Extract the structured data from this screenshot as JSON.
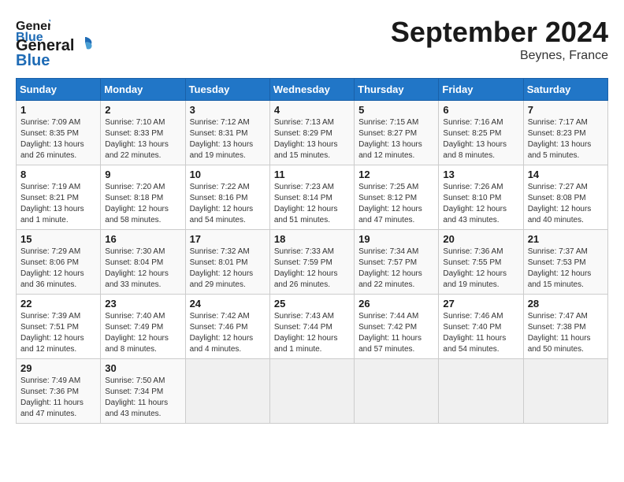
{
  "header": {
    "logo_line1": "General",
    "logo_line2": "Blue",
    "month": "September 2024",
    "location": "Beynes, France"
  },
  "days_of_week": [
    "Sunday",
    "Monday",
    "Tuesday",
    "Wednesday",
    "Thursday",
    "Friday",
    "Saturday"
  ],
  "weeks": [
    [
      {
        "day": "1",
        "info": "Sunrise: 7:09 AM\nSunset: 8:35 PM\nDaylight: 13 hours\nand 26 minutes."
      },
      {
        "day": "2",
        "info": "Sunrise: 7:10 AM\nSunset: 8:33 PM\nDaylight: 13 hours\nand 22 minutes."
      },
      {
        "day": "3",
        "info": "Sunrise: 7:12 AM\nSunset: 8:31 PM\nDaylight: 13 hours\nand 19 minutes."
      },
      {
        "day": "4",
        "info": "Sunrise: 7:13 AM\nSunset: 8:29 PM\nDaylight: 13 hours\nand 15 minutes."
      },
      {
        "day": "5",
        "info": "Sunrise: 7:15 AM\nSunset: 8:27 PM\nDaylight: 13 hours\nand 12 minutes."
      },
      {
        "day": "6",
        "info": "Sunrise: 7:16 AM\nSunset: 8:25 PM\nDaylight: 13 hours\nand 8 minutes."
      },
      {
        "day": "7",
        "info": "Sunrise: 7:17 AM\nSunset: 8:23 PM\nDaylight: 13 hours\nand 5 minutes."
      }
    ],
    [
      {
        "day": "8",
        "info": "Sunrise: 7:19 AM\nSunset: 8:21 PM\nDaylight: 13 hours\nand 1 minute."
      },
      {
        "day": "9",
        "info": "Sunrise: 7:20 AM\nSunset: 8:18 PM\nDaylight: 12 hours\nand 58 minutes."
      },
      {
        "day": "10",
        "info": "Sunrise: 7:22 AM\nSunset: 8:16 PM\nDaylight: 12 hours\nand 54 minutes."
      },
      {
        "day": "11",
        "info": "Sunrise: 7:23 AM\nSunset: 8:14 PM\nDaylight: 12 hours\nand 51 minutes."
      },
      {
        "day": "12",
        "info": "Sunrise: 7:25 AM\nSunset: 8:12 PM\nDaylight: 12 hours\nand 47 minutes."
      },
      {
        "day": "13",
        "info": "Sunrise: 7:26 AM\nSunset: 8:10 PM\nDaylight: 12 hours\nand 43 minutes."
      },
      {
        "day": "14",
        "info": "Sunrise: 7:27 AM\nSunset: 8:08 PM\nDaylight: 12 hours\nand 40 minutes."
      }
    ],
    [
      {
        "day": "15",
        "info": "Sunrise: 7:29 AM\nSunset: 8:06 PM\nDaylight: 12 hours\nand 36 minutes."
      },
      {
        "day": "16",
        "info": "Sunrise: 7:30 AM\nSunset: 8:04 PM\nDaylight: 12 hours\nand 33 minutes."
      },
      {
        "day": "17",
        "info": "Sunrise: 7:32 AM\nSunset: 8:01 PM\nDaylight: 12 hours\nand 29 minutes."
      },
      {
        "day": "18",
        "info": "Sunrise: 7:33 AM\nSunset: 7:59 PM\nDaylight: 12 hours\nand 26 minutes."
      },
      {
        "day": "19",
        "info": "Sunrise: 7:34 AM\nSunset: 7:57 PM\nDaylight: 12 hours\nand 22 minutes."
      },
      {
        "day": "20",
        "info": "Sunrise: 7:36 AM\nSunset: 7:55 PM\nDaylight: 12 hours\nand 19 minutes."
      },
      {
        "day": "21",
        "info": "Sunrise: 7:37 AM\nSunset: 7:53 PM\nDaylight: 12 hours\nand 15 minutes."
      }
    ],
    [
      {
        "day": "22",
        "info": "Sunrise: 7:39 AM\nSunset: 7:51 PM\nDaylight: 12 hours\nand 12 minutes."
      },
      {
        "day": "23",
        "info": "Sunrise: 7:40 AM\nSunset: 7:49 PM\nDaylight: 12 hours\nand 8 minutes."
      },
      {
        "day": "24",
        "info": "Sunrise: 7:42 AM\nSunset: 7:46 PM\nDaylight: 12 hours\nand 4 minutes."
      },
      {
        "day": "25",
        "info": "Sunrise: 7:43 AM\nSunset: 7:44 PM\nDaylight: 12 hours\nand 1 minute."
      },
      {
        "day": "26",
        "info": "Sunrise: 7:44 AM\nSunset: 7:42 PM\nDaylight: 11 hours\nand 57 minutes."
      },
      {
        "day": "27",
        "info": "Sunrise: 7:46 AM\nSunset: 7:40 PM\nDaylight: 11 hours\nand 54 minutes."
      },
      {
        "day": "28",
        "info": "Sunrise: 7:47 AM\nSunset: 7:38 PM\nDaylight: 11 hours\nand 50 minutes."
      }
    ],
    [
      {
        "day": "29",
        "info": "Sunrise: 7:49 AM\nSunset: 7:36 PM\nDaylight: 11 hours\nand 47 minutes."
      },
      {
        "day": "30",
        "info": "Sunrise: 7:50 AM\nSunset: 7:34 PM\nDaylight: 11 hours\nand 43 minutes."
      },
      {
        "day": "",
        "info": ""
      },
      {
        "day": "",
        "info": ""
      },
      {
        "day": "",
        "info": ""
      },
      {
        "day": "",
        "info": ""
      },
      {
        "day": "",
        "info": ""
      }
    ]
  ]
}
